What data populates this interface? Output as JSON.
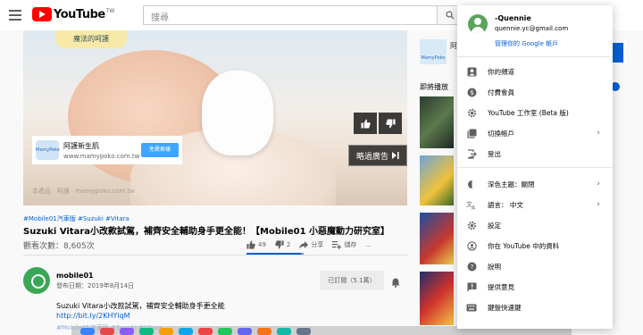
{
  "header": {
    "logo_text": "YouTube",
    "logo_region": "TW",
    "search_placeholder": "搜尋"
  },
  "player": {
    "ad_badge": "魔法的呵護",
    "ad_card": {
      "title": "阿護新生肌",
      "url": "www.mamypoko.com.tw",
      "button": "免費索樣",
      "logo": "MamyPoko"
    },
    "skip_label": "略過廣告",
    "watermark": "本產品 · 阿護 · mamypoko.com.tw"
  },
  "video": {
    "tags": "#Mobile01汽車版 #Suzuki #Vitara",
    "title": "Suzuki Vitara小改款試駕，補齊安全輔助身手更全能！【Mobile01 小惡魔動力研究室】",
    "views": "觀看次數：8,605次",
    "likes": "49",
    "dislikes": "2",
    "like_ratio": 0.96,
    "share_label": "分享",
    "save_label": "儲存",
    "more_label": "..."
  },
  "channel": {
    "name": "mobile01",
    "publish_date": "發布日期：2019年8月14日",
    "subscribe_label": "已訂閱（5.1萬）",
    "desc_line1": "Suzuki Vitara小改款試駕，補齊安全輔助身手更全能",
    "desc_link": "http://bit.ly/2KHYlqM",
    "desc_faded": "#Mobile01汽車版 #Suzuki #Vitara"
  },
  "sidebar": {
    "ad_text": "阿",
    "ad_logo": "MamyPoko",
    "up_next": "即將播放"
  },
  "menu": {
    "account_name": "-Quennie",
    "account_email": "quennie.yc@gmail.com",
    "manage_link": "管理你的 Google 帳戶",
    "items": [
      {
        "label": "你的頻道",
        "icon": "person-icon",
        "chevron": false
      },
      {
        "label": "付費會員",
        "icon": "dollar-icon",
        "chevron": false
      },
      {
        "label": "YouTube 工作室 (Beta 版)",
        "icon": "gear-icon",
        "chevron": false
      },
      {
        "label": "切換帳戶",
        "icon": "switch-account-icon",
        "chevron": true
      },
      {
        "label": "登出",
        "icon": "sign-out-icon",
        "chevron": false
      },
      {
        "label": "深色主題：關閉",
        "icon": "dark-theme-icon",
        "chevron": true
      },
      {
        "label": "語言： 中文",
        "icon": "language-icon",
        "chevron": true
      },
      {
        "label": "設定",
        "icon": "settings-icon",
        "chevron": false
      },
      {
        "label": "你在 YouTube 中的資料",
        "icon": "data-shield-icon",
        "chevron": false
      },
      {
        "label": "說明",
        "icon": "help-icon",
        "chevron": false
      },
      {
        "label": "提供意見",
        "icon": "feedback-icon",
        "chevron": false
      },
      {
        "label": "鍵盤快速鍵",
        "icon": "keyboard-icon",
        "chevron": false
      }
    ]
  },
  "colors": {
    "brand_red": "#ff0000",
    "link_blue": "#065fd4",
    "subscribe_gray": "#ececec"
  }
}
